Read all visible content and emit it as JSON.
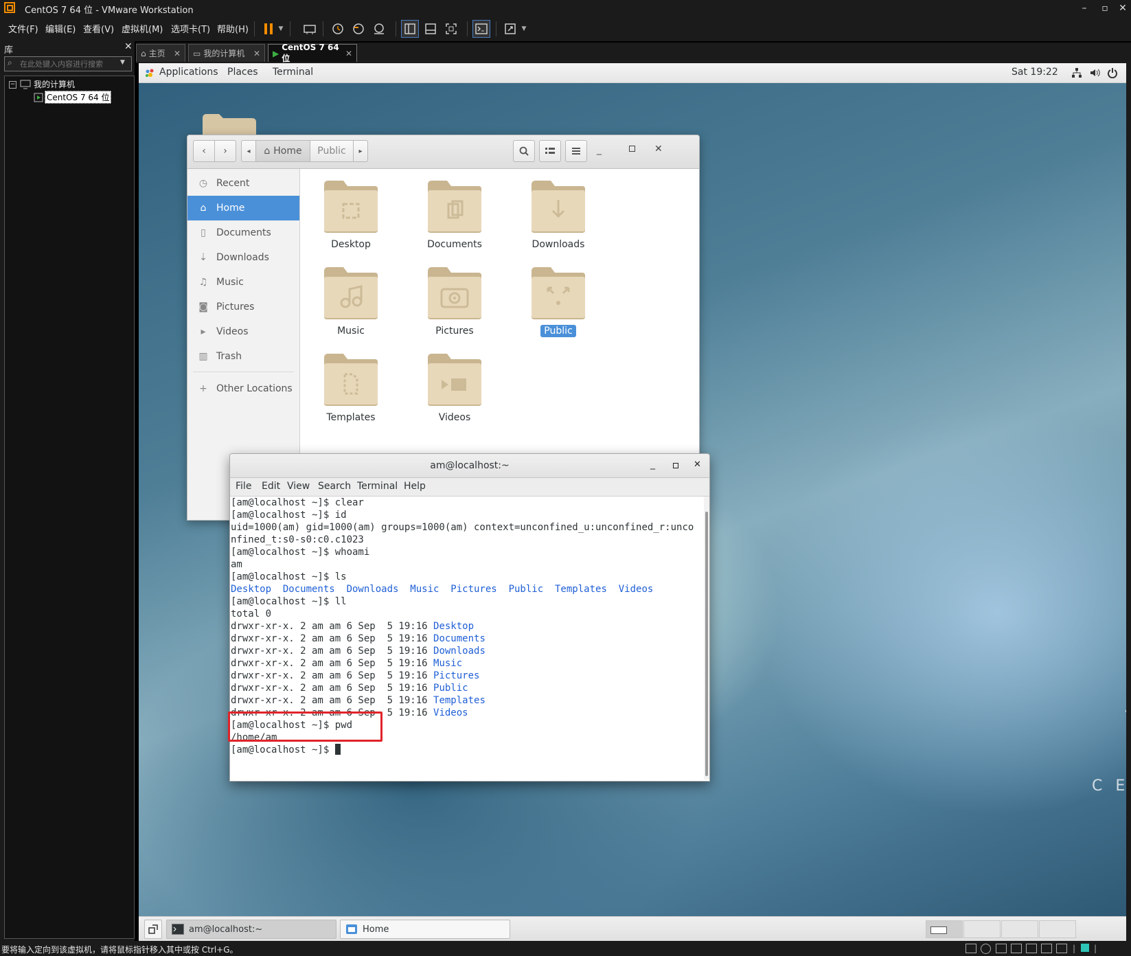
{
  "vmware": {
    "window_title": "CentOS 7 64 位 - VMware Workstation",
    "menu": [
      "文件(F)",
      "编辑(E)",
      "查看(V)",
      "虚拟机(M)",
      "选项卡(T)",
      "帮助(H)"
    ],
    "library": {
      "header": "库",
      "search_placeholder": "在此处键入内容进行搜索",
      "tree_root": "我的计算机",
      "tree_child": "CentOS 7 64 位"
    },
    "tabs": [
      {
        "label": "主页"
      },
      {
        "label": "我的计算机"
      },
      {
        "label": "CentOS 7 64 位"
      }
    ],
    "status_text": "要将输入定向到该虚拟机，请将鼠标指针移入其中或按 Ctrl+G。"
  },
  "gnome": {
    "top_menu": [
      "Applications",
      "Places",
      "Terminal"
    ],
    "clock": "Sat 19:22",
    "desktop_watermark": "C E"
  },
  "files": {
    "path": [
      "Home",
      "Public"
    ],
    "sidebar": [
      {
        "label": "Recent",
        "icon": "clock-icon"
      },
      {
        "label": "Home",
        "icon": "home-icon",
        "active": true
      },
      {
        "label": "Documents",
        "icon": "document-icon"
      },
      {
        "label": "Downloads",
        "icon": "download-icon"
      },
      {
        "label": "Music",
        "icon": "music-icon"
      },
      {
        "label": "Pictures",
        "icon": "camera-icon"
      },
      {
        "label": "Videos",
        "icon": "video-icon"
      },
      {
        "label": "Trash",
        "icon": "trash-icon"
      },
      {
        "label": "Other Locations",
        "icon": "plus-icon"
      }
    ],
    "folders": [
      {
        "label": "Desktop",
        "icon": "desktop-folder-icon"
      },
      {
        "label": "Documents",
        "icon": "documents-folder-icon"
      },
      {
        "label": "Downloads",
        "icon": "downloads-folder-icon"
      },
      {
        "label": "Music",
        "icon": "music-folder-icon"
      },
      {
        "label": "Pictures",
        "icon": "pictures-folder-icon"
      },
      {
        "label": "Public",
        "icon": "public-folder-icon",
        "selected": true
      },
      {
        "label": "Templates",
        "icon": "templates-folder-icon"
      },
      {
        "label": "Videos",
        "icon": "videos-folder-icon"
      }
    ]
  },
  "terminal": {
    "title": "am@localhost:~",
    "menu": [
      "File",
      "Edit",
      "View",
      "Search",
      "Terminal",
      "Help"
    ],
    "lines": [
      {
        "text": "[am@localhost ~]$ clear"
      },
      {
        "text": "[am@localhost ~]$ id"
      },
      {
        "text": "uid=1000(am) gid=1000(am) groups=1000(am) context=unconfined_u:unconfined_r:unco"
      },
      {
        "text": "nfined_t:s0-s0:c0.c1023"
      },
      {
        "text": "[am@localhost ~]$ whoami"
      },
      {
        "text": "am"
      },
      {
        "text": "[am@localhost ~]$ ls"
      },
      {
        "text": "",
        "blue": "Desktop  Documents  Downloads  Music  Pictures  Public  Templates  Videos"
      },
      {
        "text": "[am@localhost ~]$ ll"
      },
      {
        "text": "total 0"
      },
      {
        "text": "drwxr-xr-x. 2 am am 6 Sep  5 19:16 ",
        "blue": "Desktop"
      },
      {
        "text": "drwxr-xr-x. 2 am am 6 Sep  5 19:16 ",
        "blue": "Documents"
      },
      {
        "text": "drwxr-xr-x. 2 am am 6 Sep  5 19:16 ",
        "blue": "Downloads"
      },
      {
        "text": "drwxr-xr-x. 2 am am 6 Sep  5 19:16 ",
        "blue": "Music"
      },
      {
        "text": "drwxr-xr-x. 2 am am 6 Sep  5 19:16 ",
        "blue": "Pictures"
      },
      {
        "text": "drwxr-xr-x. 2 am am 6 Sep  5 19:16 ",
        "blue": "Public"
      },
      {
        "text": "drwxr-xr-x. 2 am am 6 Sep  5 19:16 ",
        "blue": "Templates"
      },
      {
        "text": "drwxr-xr-x. 2 am am 6 Sep  5 19:16 ",
        "blue": "Videos"
      },
      {
        "text": "[am@localhost ~]$ pwd"
      },
      {
        "text": "/home/am"
      },
      {
        "text": "[am@localhost ~]$ ",
        "cursor": true
      }
    ],
    "highlight_color": "#e0242a"
  },
  "taskbar": {
    "items": [
      {
        "label": "am@localhost:~",
        "icon": "terminal-icon"
      },
      {
        "label": "Home",
        "icon": "files-icon"
      }
    ]
  },
  "colors": {
    "selection_blue": "#4a90d9",
    "link_blue": "#1f5fd6",
    "vmware_dark": "#1b1b1b"
  }
}
